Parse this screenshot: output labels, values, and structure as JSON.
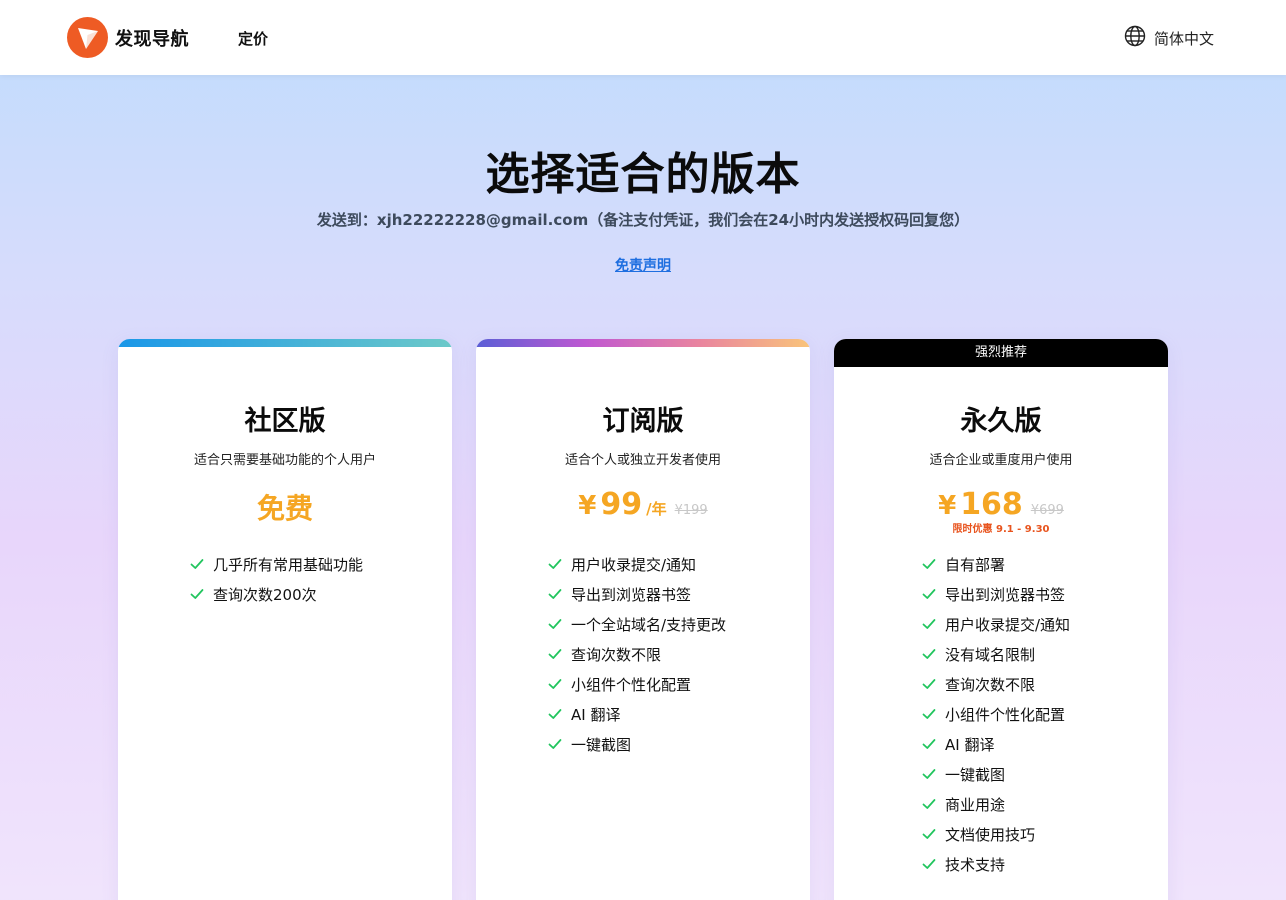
{
  "header": {
    "brand_name": "发现导航",
    "nav_pricing": "定价",
    "language": "简体中文"
  },
  "hero": {
    "title": "选择适合的版本",
    "subtitle": "发送到：xjh22222228@gmail.com（备注支付凭证，我们会在24小时内发送授权码回复您）",
    "disclaimer": "免责声明"
  },
  "plans": [
    {
      "title": "社区版",
      "desc": "适合只需要基础功能的个人用户",
      "price_free": "免费",
      "features": [
        "几乎所有常用基础功能",
        "查询次数200次"
      ]
    },
    {
      "title": "订阅版",
      "desc": "适合个人或独立开发者使用",
      "currency": "¥",
      "price": "99",
      "period": "/年",
      "original": "¥199",
      "features": [
        "用户收录提交/通知",
        "导出到浏览器书签",
        "一个全站域名/支持更改",
        "查询次数不限",
        "小组件个性化配置",
        "AI 翻译",
        "一键截图"
      ]
    },
    {
      "title": "永久版",
      "badge": "强烈推荐",
      "desc": "适合企业或重度用户使用",
      "currency": "¥",
      "price": "168",
      "original": "¥699",
      "promo": "限时优惠 9.1 - 9.30",
      "features": [
        "自有部署",
        "导出到浏览器书签",
        "用户收录提交/通知",
        "没有域名限制",
        "查询次数不限",
        "小组件个性化配置",
        "AI 翻译",
        "一键截图",
        "商业用途",
        "文档使用技巧",
        "技术支持"
      ]
    }
  ],
  "colors": {
    "accent_price": "#f5a623",
    "check": "#22c55e",
    "promo": "#e8541e",
    "logo": "#ee5b24",
    "link": "#1f6fe0"
  }
}
